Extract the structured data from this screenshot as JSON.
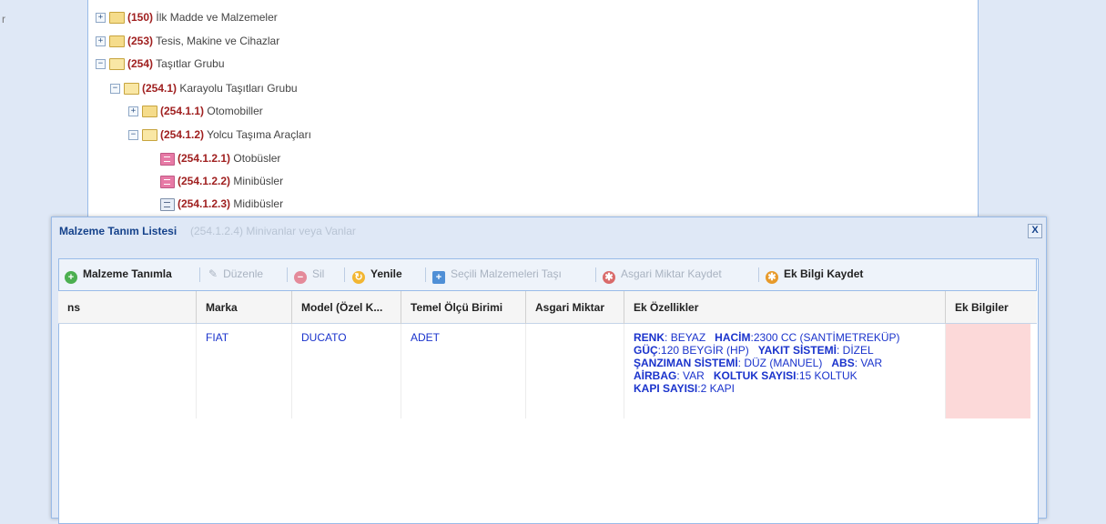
{
  "tree": {
    "items": [
      {
        "code": "150",
        "name": "İlk Madde ve Malzemeler"
      },
      {
        "code": "253",
        "name": "Tesis, Makine ve Cihazlar"
      },
      {
        "code": "254",
        "name": "Taşıtlar Grubu"
      },
      {
        "code": "254.1",
        "name": "Karayolu Taşıtları Grubu"
      },
      {
        "code": "254.1.1",
        "name": "Otomobiller"
      },
      {
        "code": "254.1.2",
        "name": "Yolcu Taşıma Araçları"
      },
      {
        "code": "254.1.2.1",
        "name": "Otobüsler"
      },
      {
        "code": "254.1.2.2",
        "name": "Minibüsler"
      },
      {
        "code": "254.1.2.3",
        "name": "Midibüsler"
      },
      {
        "code": "254.1.2.4",
        "name": "Minivanlar veya Vanlar"
      }
    ]
  },
  "dialog": {
    "title": "Malzeme Tanım Listesi",
    "close_label": "X"
  },
  "toolbar": {
    "add": "Malzeme Tanımla",
    "edit": "Düzenle",
    "delete": "Sil",
    "refresh": "Yenile",
    "move": "Seçili Malzemeleri Taşı",
    "save_min": "Asgari Miktar Kaydet",
    "save_extra": "Ek Bilgi Kaydet"
  },
  "grid": {
    "columns": [
      "ns",
      "Marka",
      "Model (Özel K...",
      "Temel Ölçü Birimi",
      "Asgari Miktar",
      "Ek Özellikler",
      "Ek Bilgiler"
    ],
    "row": {
      "marka": "FIAT",
      "model": "DUCATO",
      "birim": "ADET",
      "asgari": "",
      "features": [
        {
          "k": "RENK",
          "v": "BEYAZ"
        },
        {
          "k": "HACİM",
          "v": "2300 CC (SANTİMETREKÜP)"
        },
        {
          "k": "GÜÇ",
          "v": "120 BEYGİR (HP)"
        },
        {
          "k": "YAKIT SİSTEMİ",
          "v": "DİZEL"
        },
        {
          "k": "ŞANZIMAN SİSTEMİ",
          "v": "DÜZ (MANUEL)"
        },
        {
          "k": "ABS",
          "v": "VAR"
        },
        {
          "k": "AİRBAG",
          "v": "VAR"
        },
        {
          "k": "KOLTUK SAYISI",
          "v": "15 KOLTUK"
        },
        {
          "k": "KAPI SAYISI",
          "v": "2 KAPI"
        }
      ]
    }
  },
  "gutter_char": "r"
}
